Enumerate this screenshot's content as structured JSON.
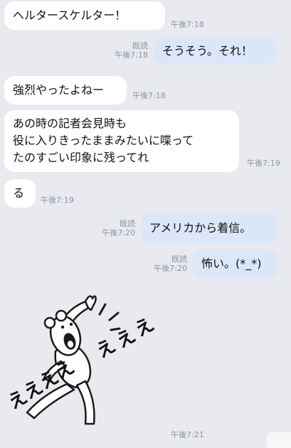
{
  "messages": [
    {
      "side": "in",
      "text": "ヘルタースケルター！",
      "time": "午後7:18"
    },
    {
      "side": "out",
      "text": "そうそう。それ！",
      "read": "既読",
      "time": "午後7:18"
    },
    {
      "side": "in",
      "text": "強烈やったよねー",
      "time": "午後7:18"
    },
    {
      "side": "in",
      "lines": [
        "あの時の記者会見時も",
        "役に入りきったままみたいに喋って",
        "たのすごい印象に残ってれ"
      ],
      "time": "午後7:19"
    },
    {
      "side": "in",
      "text": "る",
      "time": "午後7:19"
    },
    {
      "side": "out",
      "text": "アメリカから着信。",
      "read": "既読",
      "time": "午後7:20"
    },
    {
      "side": "out",
      "text": "怖い。(*_*)",
      "read": "既読",
      "time": "午後7:20"
    },
    {
      "side": "in",
      "sticker": "shouting-bear-sticker",
      "sticker_text": "えええええええ",
      "time": "午後7:21"
    }
  ],
  "colors": {
    "background": "#e8eaef",
    "incoming_bubble": "#ffffff",
    "outgoing_bubble": "#dbe7f9",
    "meta_text": "#8e939b"
  }
}
